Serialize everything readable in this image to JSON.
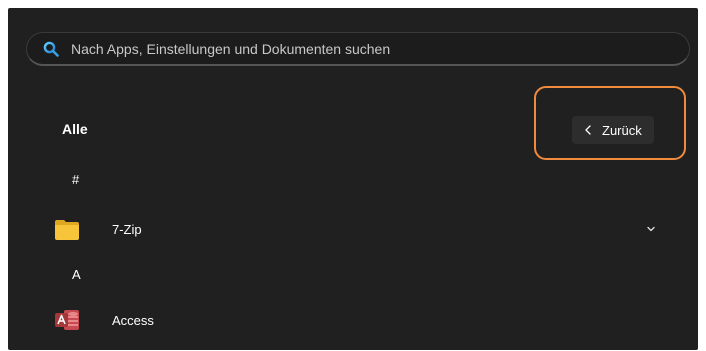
{
  "search": {
    "placeholder": "Nach Apps, Einstellungen und Dokumenten suchen",
    "icon": "search-icon"
  },
  "header": {
    "title": "Alle",
    "back_label": "Zurück",
    "back_icon": "chevron-left-icon"
  },
  "apps": {
    "groups": [
      {
        "letter": "#",
        "items": [
          {
            "label": "7-Zip",
            "icon": "folder-icon",
            "expandable": true
          }
        ]
      },
      {
        "letter": "A",
        "items": [
          {
            "label": "Access",
            "icon": "access-icon",
            "expandable": false
          }
        ]
      }
    ]
  },
  "colors": {
    "background": "#202020",
    "highlight": "#f08a3c",
    "folder": "#f6c53a",
    "access": "#a4373a",
    "search_accent": "#3fa9e8"
  }
}
